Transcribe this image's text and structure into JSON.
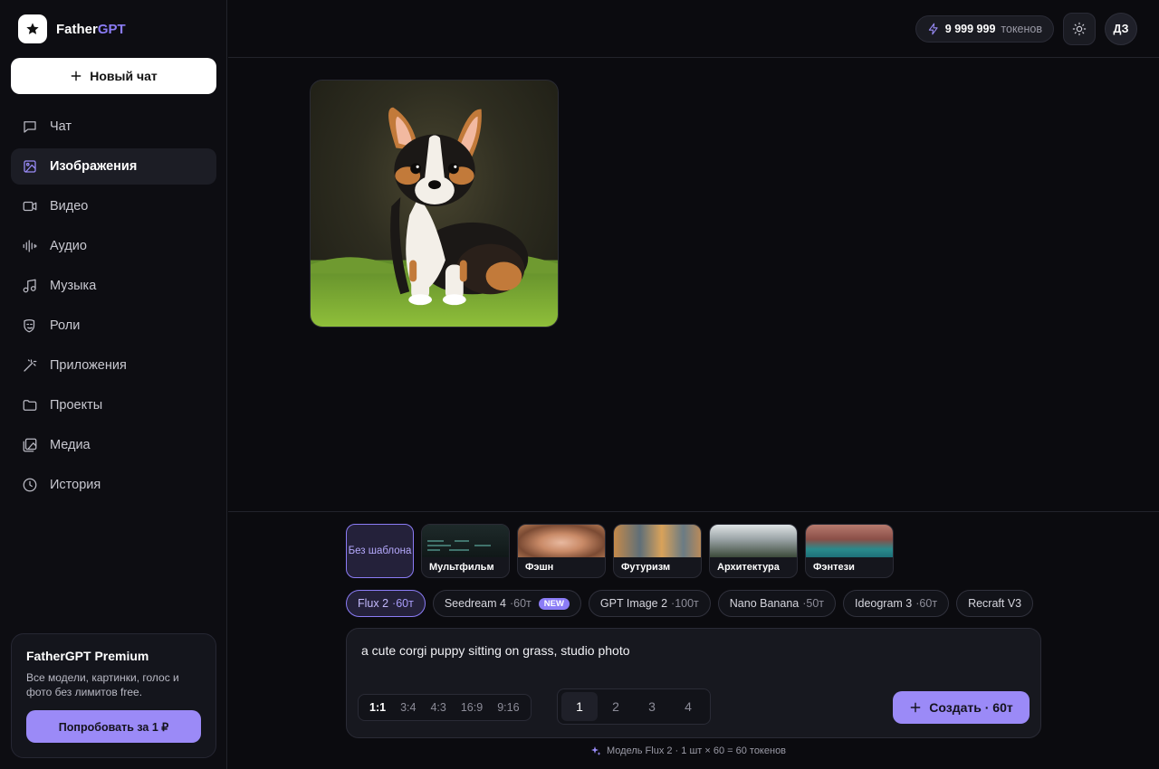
{
  "brand": {
    "name_main": "Father",
    "name_accent": "GPT"
  },
  "sidebar": {
    "new_chat": "Новый чат",
    "items": [
      {
        "label": "Чат",
        "icon": "chat-icon"
      },
      {
        "label": "Изображения",
        "icon": "image-icon",
        "active": true
      },
      {
        "label": "Видео",
        "icon": "video-icon"
      },
      {
        "label": "Аудио",
        "icon": "audio-icon"
      },
      {
        "label": "Музыка",
        "icon": "music-icon"
      },
      {
        "label": "Роли",
        "icon": "roles-icon"
      },
      {
        "label": "Приложения",
        "icon": "wand-icon"
      },
      {
        "label": "Проекты",
        "icon": "folder-icon"
      },
      {
        "label": "Медиа",
        "icon": "media-icon"
      },
      {
        "label": "История",
        "icon": "clock-icon"
      }
    ],
    "premium": {
      "title": "FatherGPT Premium",
      "description": "Все модели, картинки, голос и фото без лимитов free.",
      "button": "Попробовать за 1 ₽"
    }
  },
  "header": {
    "tokens_value": "9 999 999",
    "tokens_unit": "токенов",
    "avatar_initials": "ДЗ"
  },
  "templates": {
    "none_label": "Без шаблона",
    "items": [
      "Мультфильм",
      "Фэшн",
      "Футуризм",
      "Архитектура",
      "Фэнтези"
    ]
  },
  "models": [
    {
      "name": "Flux 2",
      "cost": "·60т",
      "active": true
    },
    {
      "name": "Seedream 4",
      "cost": "·60т",
      "badge": "NEW"
    },
    {
      "name": "GPT Image 2",
      "cost": "·100т"
    },
    {
      "name": "Nano Banana",
      "cost": "·50т"
    },
    {
      "name": "Ideogram 3",
      "cost": "·60т"
    },
    {
      "name": "Recraft V3",
      "cost": ""
    }
  ],
  "composer": {
    "prompt": "a cute corgi puppy sitting on grass, studio photo",
    "ratios": [
      "1:1",
      "3:4",
      "4:3",
      "16:9",
      "9:16"
    ],
    "active_ratio": "1:1",
    "counts": [
      "1",
      "2",
      "3",
      "4"
    ],
    "active_count": "1",
    "create_button": "Создать · 60т",
    "footnote": "Модель Flux 2 · 1 шт × 60 = 60 токенов"
  },
  "colors": {
    "accent": "#9b8af7",
    "background": "#0b0b0f",
    "sidebar": "#0d0d12"
  }
}
